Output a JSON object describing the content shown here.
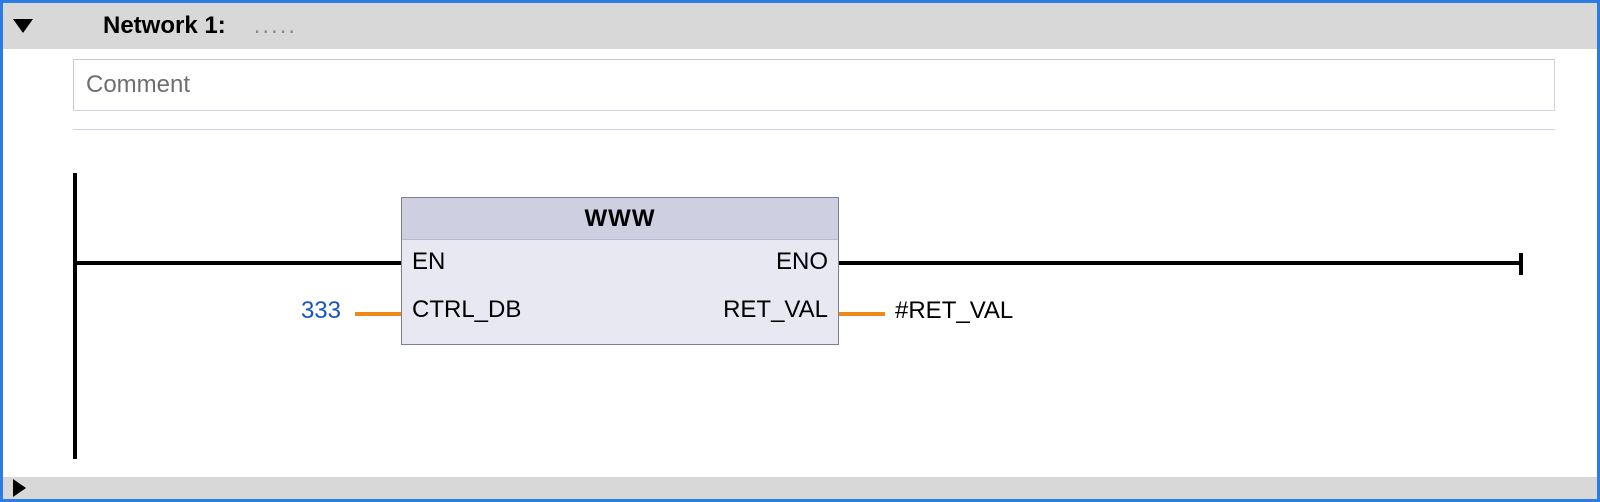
{
  "network": {
    "title": "Network 1:",
    "subtitle": ".....",
    "comment_placeholder": "Comment"
  },
  "block": {
    "name": "WWW",
    "pins": {
      "en": "EN",
      "eno": "ENO",
      "ctrl_db": "CTRL_DB",
      "ret_val": "RET_VAL"
    },
    "inputs": {
      "ctrl_db_value": "333"
    },
    "outputs": {
      "ret_val_target": "#RET_VAL"
    }
  },
  "next_network": {
    "title": ""
  }
}
